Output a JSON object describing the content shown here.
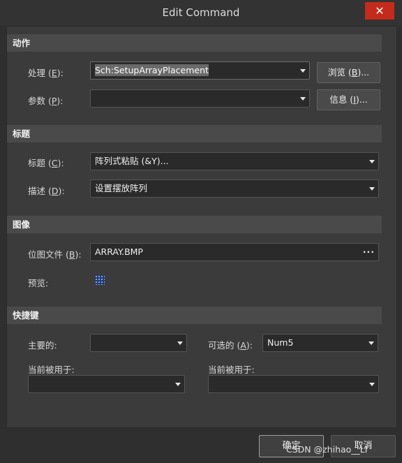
{
  "window": {
    "title": "Edit Command",
    "close_label": "✕"
  },
  "sections": {
    "action": "动作",
    "title": "标题",
    "image": "图像",
    "shortcut": "快捷键"
  },
  "action": {
    "process_label": "处理 (",
    "process_key": "E",
    "process_tail": "):",
    "process_value": "Sch:SetupArrayPlacement",
    "params_label": "参数 (",
    "params_key": "P",
    "params_tail": "):",
    "params_value": "",
    "browse_label": "浏览 (",
    "browse_key": "B",
    "browse_tail": ")...",
    "info_label": "信息 (",
    "info_key": "I",
    "info_tail": ")..."
  },
  "titlesec": {
    "caption_label": "标题 (",
    "caption_key": "C",
    "caption_tail": "):",
    "caption_value": "阵列式粘贴 (&Y)...",
    "desc_label": "描述 (",
    "desc_key": "D",
    "desc_tail": "):",
    "desc_value": "设置摆放阵列"
  },
  "imagesec": {
    "bitmap_label": "位图文件 (",
    "bitmap_key": "B",
    "bitmap_tail": "):",
    "bitmap_value": "ARRAY.BMP",
    "preview_label": "预览:"
  },
  "shortcut": {
    "primary_label": "主要的:",
    "primary_value": "",
    "alt_label": "可选的 (",
    "alt_key": "A",
    "alt_tail": "):",
    "alt_value": "Num5",
    "used_by_1": "当前被用于:",
    "used_by_2": "当前被用于:"
  },
  "footer": {
    "ok": "确定",
    "cancel": "取消"
  },
  "watermark": "CSDN @zhihao__LI"
}
